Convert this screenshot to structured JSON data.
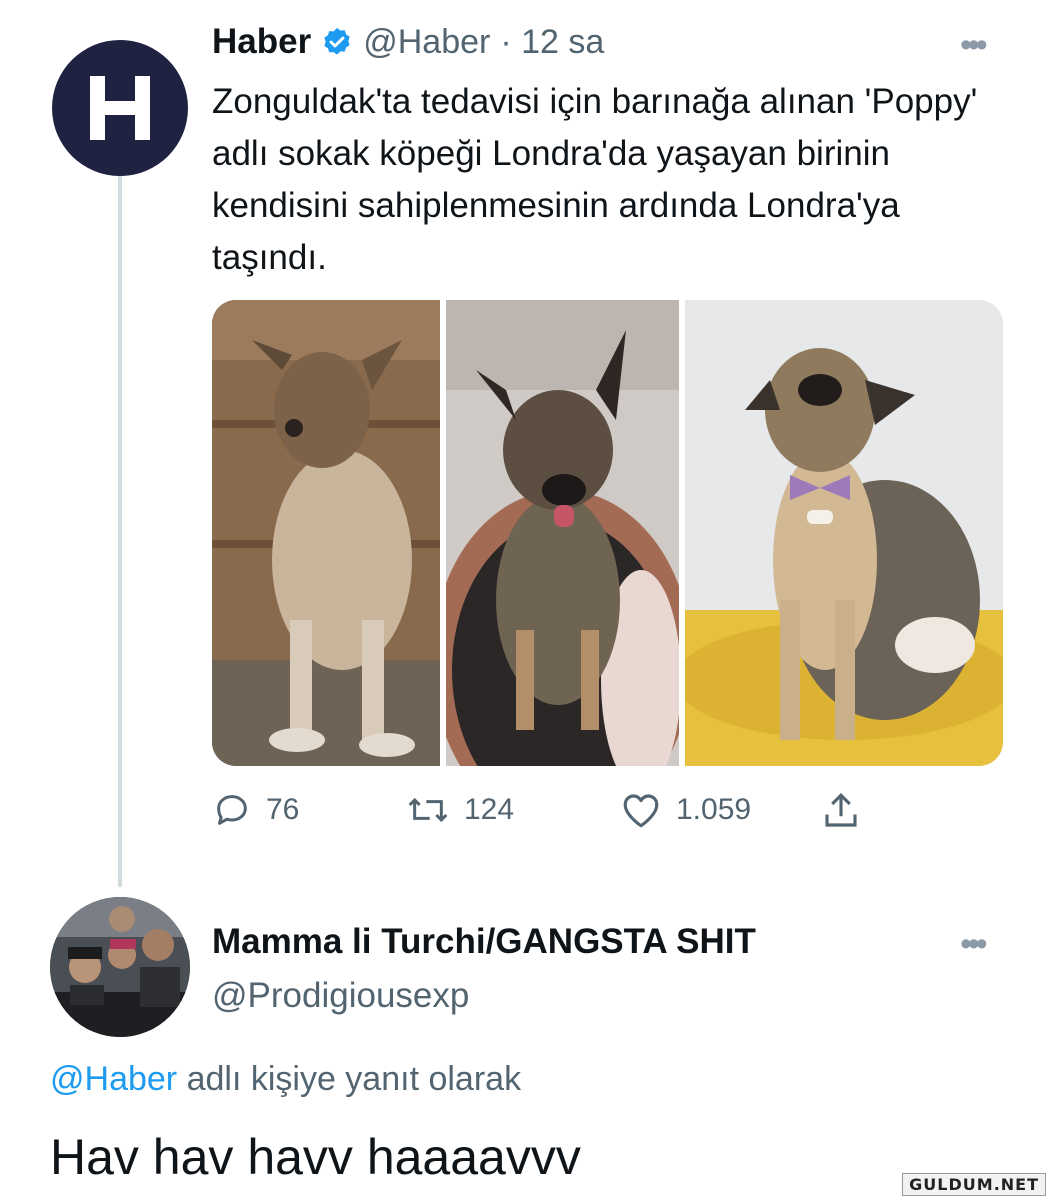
{
  "tweet": {
    "author_name": "Haber",
    "handle": "@Haber",
    "time": "· 12 sa",
    "text": "Zonguldak'ta tedavisi için barınağa alınan 'Poppy' adlı sokak köpeği Londra'da yaşayan birinin kendisini sahiplenmesinin ardında Londra'ya taşındı.",
    "avatar_letter": "H",
    "actions": {
      "replies": "76",
      "retweets": "124",
      "likes": "1.059"
    }
  },
  "reply": {
    "author_name": "Mamma li Turchi/GANGSTA SHIT",
    "handle": "@Prodigiousexp",
    "replying_to_handle": "@Haber",
    "replying_to_suffix": "adlı kişiye yanıt olarak",
    "text": "Hav hav havv haaaavvv"
  },
  "watermark": "GULDUM.NET",
  "colors": {
    "accent": "#1d9bf0",
    "muted": "#536471",
    "verified": "#1d9bf0",
    "avatar_bg": "#1f2240"
  },
  "icons": [
    "more-icon",
    "verified-badge-icon",
    "reply-icon",
    "retweet-icon",
    "like-icon",
    "share-icon"
  ]
}
